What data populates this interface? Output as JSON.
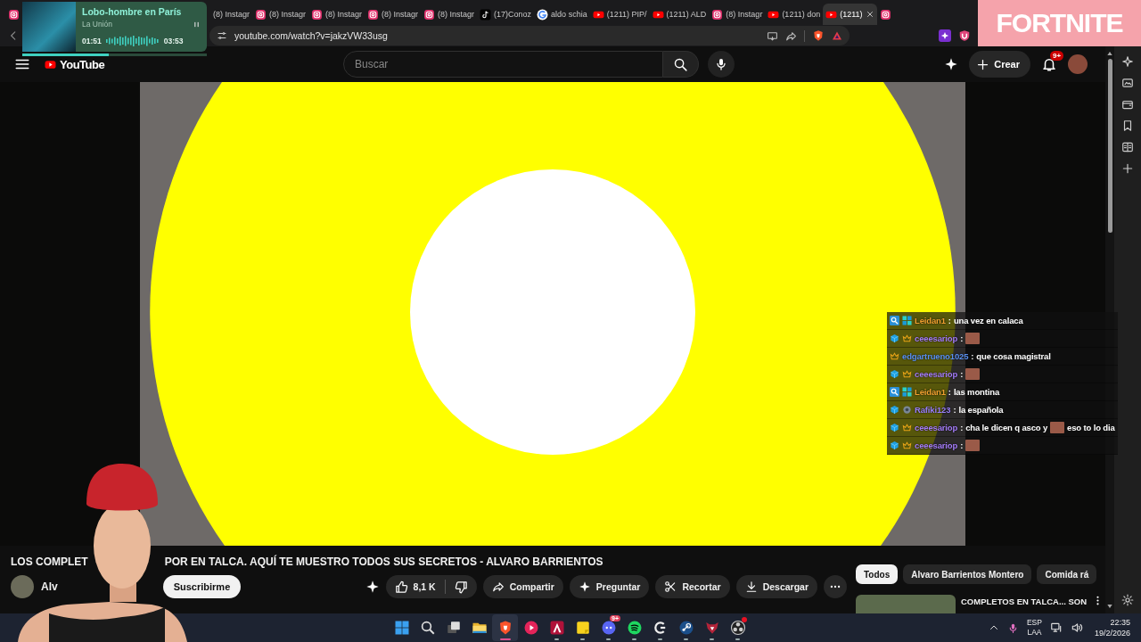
{
  "browser": {
    "tabs": [
      {
        "kind": "instagram",
        "selected": false
      },
      {
        "label": "(8) Instagr",
        "selected": false
      },
      {
        "kind": "instagram",
        "label": "(8) Instagr",
        "selected": false
      },
      {
        "kind": "instagram",
        "label": "(8) Instagr",
        "selected": false
      },
      {
        "kind": "instagram",
        "label": "(8) Instagr",
        "selected": false
      },
      {
        "kind": "instagram",
        "label": "(8) Instagr",
        "selected": false
      },
      {
        "kind": "tiktok",
        "label": "(17)Conoz",
        "selected": false
      },
      {
        "kind": "google",
        "label": "aldo schia",
        "selected": false
      },
      {
        "kind": "youtube",
        "label": "(1211) PIP/",
        "selected": false
      },
      {
        "kind": "youtube",
        "label": "(1211) ALD",
        "selected": false
      },
      {
        "kind": "instagram",
        "label": "(8) Instagr",
        "selected": false
      },
      {
        "kind": "youtube",
        "label": "(1211) don",
        "selected": false
      },
      {
        "kind": "youtube",
        "label": "(1211)",
        "selected": true
      },
      {
        "kind": "instagram",
        "selected": false
      }
    ],
    "address": "youtube.com/watch?v=jakzVW33usg"
  },
  "music": {
    "title": "Lobo-hombre en París",
    "artist": "La Unión",
    "elapsed": "01:51",
    "duration": "03:53",
    "level": 0.47
  },
  "ad": {
    "text": "FORTNITE"
  },
  "youtube": {
    "logo": "YouTube",
    "search_placeholder": "Buscar",
    "create": "Crear",
    "notifications": "9+",
    "chat": [
      {
        "badges": [
          {
            "kind": "magnifier"
          },
          {
            "kind": "blocks"
          }
        ],
        "user": "Leidan1",
        "color": "#f0a030",
        "sep": ":",
        "parts": [
          {
            "kind": "text",
            "text": "una vez en calaca"
          }
        ]
      },
      {
        "badges": [
          {
            "kind": "cube"
          },
          {
            "kind": "crown"
          }
        ],
        "user": "ceeesariop",
        "color": "#a47cf8",
        "sep": ":",
        "parts": [
          {
            "kind": "emote"
          }
        ]
      },
      {
        "badges": [
          {
            "kind": "crown"
          }
        ],
        "user": "edgartrueno1025",
        "color": "#5a90f0",
        "sep": ":",
        "parts": [
          {
            "kind": "text",
            "text": "que cosa magistral"
          }
        ]
      },
      {
        "badges": [
          {
            "kind": "cube"
          },
          {
            "kind": "crown"
          }
        ],
        "user": "ceeesariop",
        "color": "#a47cf8",
        "sep": ":",
        "parts": [
          {
            "kind": "emote"
          }
        ]
      },
      {
        "badges": [
          {
            "kind": "magnifier"
          },
          {
            "kind": "blocks"
          }
        ],
        "user": "Leidan1",
        "color": "#f0a030",
        "sep": ":",
        "parts": [
          {
            "kind": "text",
            "text": "las montina"
          }
        ]
      },
      {
        "badges": [
          {
            "kind": "cube"
          },
          {
            "kind": "orb"
          }
        ],
        "user": "Rafiki123",
        "color": "#9a80fa",
        "sep": ":",
        "parts": [
          {
            "kind": "text",
            "text": "la española"
          }
        ]
      },
      {
        "badges": [
          {
            "kind": "cube"
          },
          {
            "kind": "crown"
          }
        ],
        "user": "ceeesariop",
        "color": "#a47cf8",
        "sep": ":",
        "parts": [
          {
            "kind": "text",
            "text": "cha le dicen q asco y"
          },
          {
            "kind": "emote"
          },
          {
            "kind": "text",
            "text": "eso to lo dia"
          }
        ]
      },
      {
        "badges": [
          {
            "kind": "cube"
          },
          {
            "kind": "crown"
          }
        ],
        "user": "ceeesariop",
        "color": "#a47cf8",
        "sep": ":",
        "parts": [
          {
            "kind": "emote"
          }
        ]
      }
    ],
    "title_parts": [
      "LOS COMPLET",
      "POR EN TALCA. AQUÍ TE MUESTRO TODOS SUS SECRETOS - ALVARO BARRIENTOS"
    ],
    "channel": "Alv",
    "subscribe": "Suscribirme",
    "likes": "8,1 K",
    "actions": [
      {
        "kind": "share",
        "label": "Compartir"
      },
      {
        "kind": "ask",
        "label": "Preguntar"
      },
      {
        "kind": "clip",
        "label": "Recortar"
      },
      {
        "kind": "download",
        "label": "Descargar"
      }
    ],
    "chips": [
      {
        "label": "Todos",
        "selected": true
      },
      {
        "label": "Alvaro Barrientos Montero",
        "selected": false
      },
      {
        "label": "Comida rá",
        "selected": false
      }
    ],
    "recommended": [
      {
        "title": "COMPLETOS EN TALCA... SON"
      }
    ]
  },
  "taskbar": {
    "apps": [
      {
        "kind": "start",
        "running": false,
        "selected": false,
        "alert": false
      },
      {
        "kind": "search",
        "running": false,
        "selected": false,
        "alert": false
      },
      {
        "kind": "taskview",
        "running": false,
        "selected": false,
        "alert": false
      },
      {
        "kind": "explorer",
        "running": false,
        "selected": false,
        "alert": false
      },
      {
        "kind": "browser",
        "running": true,
        "selected": true,
        "alert": false
      },
      {
        "kind": "player",
        "running": false,
        "selected": false,
        "alert": false
      },
      {
        "kind": "triangle",
        "running": true,
        "selected": false,
        "alert": false
      },
      {
        "kind": "notes",
        "running": true,
        "selected": false,
        "alert": false
      },
      {
        "kind": "chat",
        "running": true,
        "selected": false,
        "alert": false,
        "badge": "9+"
      },
      {
        "kind": "music",
        "running": true,
        "selected": false,
        "alert": false
      },
      {
        "kind": "ghub",
        "running": true,
        "selected": false,
        "alert": false
      },
      {
        "kind": "games",
        "running": true,
        "selected": false,
        "alert": false
      },
      {
        "kind": "mask",
        "running": true,
        "selected": false,
        "alert": false
      },
      {
        "kind": "recorder",
        "running": true,
        "selected": false,
        "alert": true
      }
    ],
    "language": "ESP",
    "layout": "LAA",
    "time": "22:35",
    "date": "19/2/2026"
  }
}
